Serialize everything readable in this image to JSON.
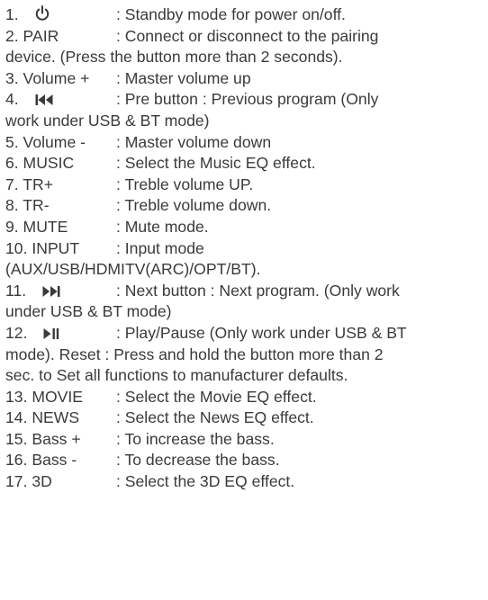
{
  "items": [
    {
      "num": "1.",
      "icon": "power-icon",
      "desc": ": Standby mode for power on/off."
    },
    {
      "num": "2. PAIR",
      "desc": ": Connect or disconnect to the pairing",
      "cont": "device. (Press the button more than 2 seconds)."
    },
    {
      "num": "3. Volume +",
      "desc": ": Master volume up"
    },
    {
      "num": "4.",
      "icon": "previous-icon",
      "desc": ": Pre button : Previous program (Only",
      "cont": "work under USB & BT mode)"
    },
    {
      "num": "5. Volume -",
      "desc": ": Master volume down"
    },
    {
      "num": "6. MUSIC",
      "desc": ": Select the Music EQ effect."
    },
    {
      "num": "7. TR+",
      "desc": ": Treble volume UP."
    },
    {
      "num": "8. TR-",
      "desc": ": Treble volume down."
    },
    {
      "num": "9. MUTE",
      "desc": ": Mute mode."
    },
    {
      "num": "10. INPUT",
      "desc": ": Input mode",
      "cont": "(AUX/USB/HDMITV(ARC)/OPT/BT)."
    },
    {
      "num": "11.",
      "icon": "next-icon",
      "desc": ": Next button : Next program. (Only work",
      "cont": "under USB & BT mode)"
    },
    {
      "num": "12.",
      "icon": "play-pause-icon",
      "desc": ": Play/Pause (Only work under USB & BT",
      "cont": "mode). Reset : Press and hold the button more than 2",
      "cont2": "sec. to Set all functions to manufacturer defaults."
    },
    {
      "num": "13. MOVIE",
      "desc": ": Select the Movie EQ effect."
    },
    {
      "num": "14. NEWS",
      "desc": ": Select the News EQ effect."
    },
    {
      "num": "15. Bass +",
      "desc": ": To increase the bass."
    },
    {
      "num": "16. Bass -",
      "desc": ": To decrease the bass."
    },
    {
      "num": "17. 3D",
      "desc": ": Select the 3D EQ effect."
    }
  ]
}
